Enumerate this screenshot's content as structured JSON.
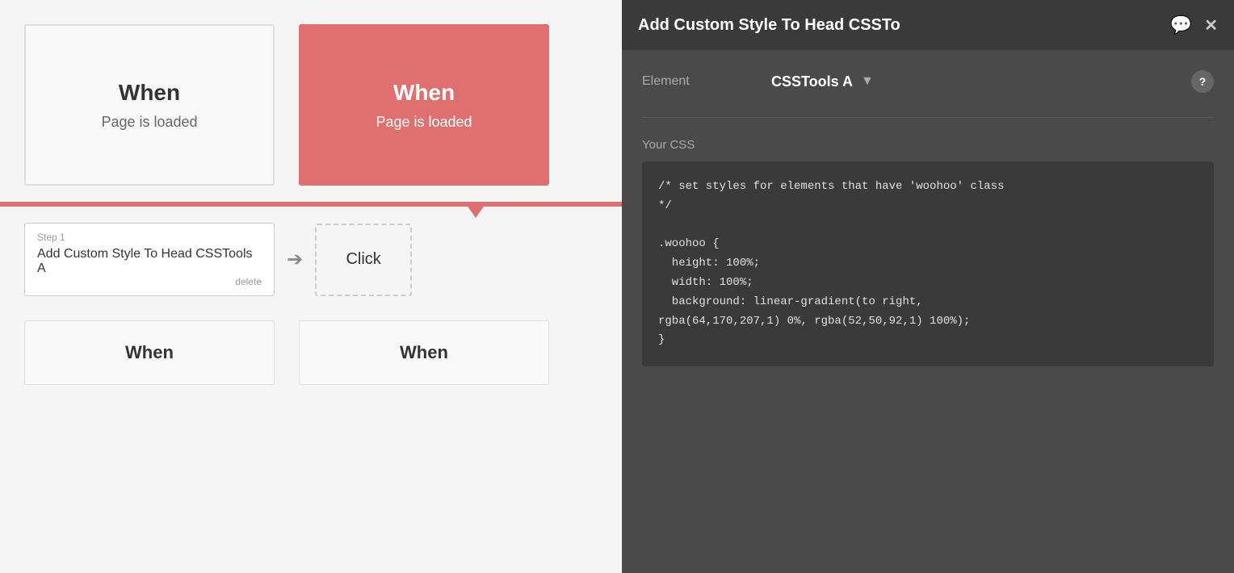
{
  "canvas": {
    "when_card_1": {
      "title": "When",
      "subtitle": "Page is loaded",
      "active": false
    },
    "when_card_2": {
      "title": "When",
      "subtitle": "Page is loaded",
      "active": true
    },
    "step": {
      "label": "Step 1",
      "title": "Add Custom Style To Head CSSTools A",
      "delete_label": "delete"
    },
    "click_label": "Click",
    "when_card_bottom_1": "When",
    "when_card_bottom_2": "When"
  },
  "panel": {
    "title": "Add Custom Style To Head CSSTo",
    "element_label": "Element",
    "element_value": "CSSTools A",
    "css_label": "Your CSS",
    "css_code": "/* set styles for elements that have 'woohoo' class\n*/\n\n.woohoo {\n  height: 100%;\n  width: 100%;\n  background: linear-gradient(to right,\nrgba(64,170,207,1) 0%, rgba(52,50,92,1) 100%);\n}",
    "comment_icon": "💬",
    "close_icon": "✕",
    "help_icon": "?"
  }
}
